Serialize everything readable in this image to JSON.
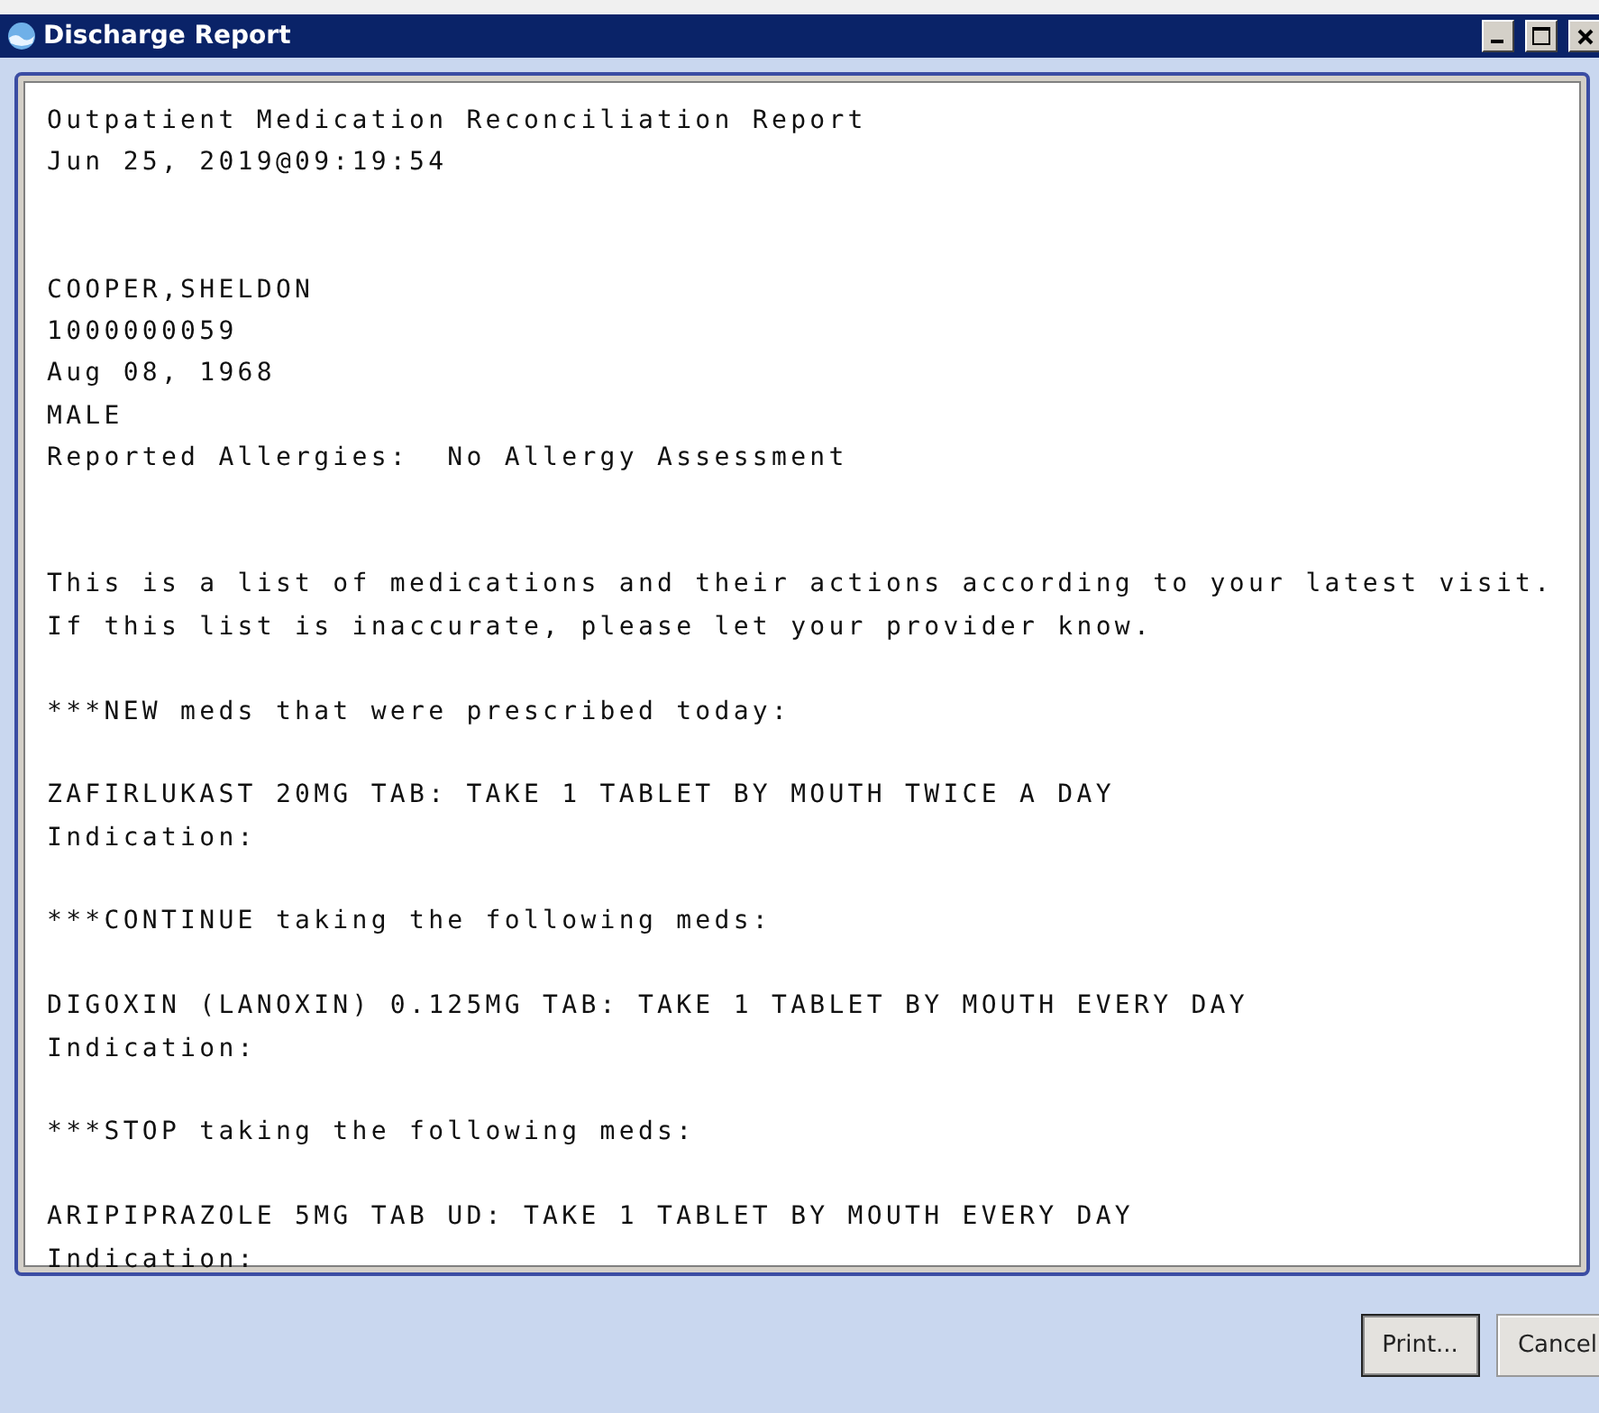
{
  "window": {
    "title": "Discharge Report"
  },
  "report": {
    "blocks": [
      {
        "kind": "double",
        "lines": [
          "Outpatient Medication Reconciliation Report",
          "Jun 25, 2019@09:19:54"
        ]
      },
      {
        "kind": "double",
        "lines": [
          "COOPER,SHELDON",
          "1000000059",
          "Aug 08, 1968",
          "MALE",
          "Reported Allergies:  No Allergy Assessment"
        ]
      },
      {
        "kind": "single",
        "lines": [
          "This is a list of medications and their actions according to your latest visit.",
          "If this list is inaccurate, please let your provider know."
        ]
      },
      {
        "kind": "single",
        "lines": [
          "***NEW meds that were prescribed today:"
        ]
      },
      {
        "kind": "single",
        "lines": [
          "ZAFIRLUKAST 20MG TAB: TAKE 1 TABLET BY MOUTH TWICE A DAY",
          "Indication:"
        ]
      },
      {
        "kind": "single",
        "lines": [
          "***CONTINUE taking the following meds:"
        ]
      },
      {
        "kind": "single",
        "lines": [
          "DIGOXIN (LANOXIN) 0.125MG TAB: TAKE 1 TABLET BY MOUTH EVERY DAY",
          "Indication:"
        ]
      },
      {
        "kind": "single",
        "lines": [
          "***STOP taking the following meds:"
        ]
      },
      {
        "kind": "single",
        "lines": [
          "ARIPIPRAZOLE 5MG TAB UD: TAKE 1 TABLET BY MOUTH EVERY DAY",
          "Indication:"
        ]
      }
    ]
  },
  "buttons": [
    {
      "label": "Print...",
      "kind": "default"
    },
    {
      "label": "Cancel",
      "kind": "normal"
    }
  ]
}
